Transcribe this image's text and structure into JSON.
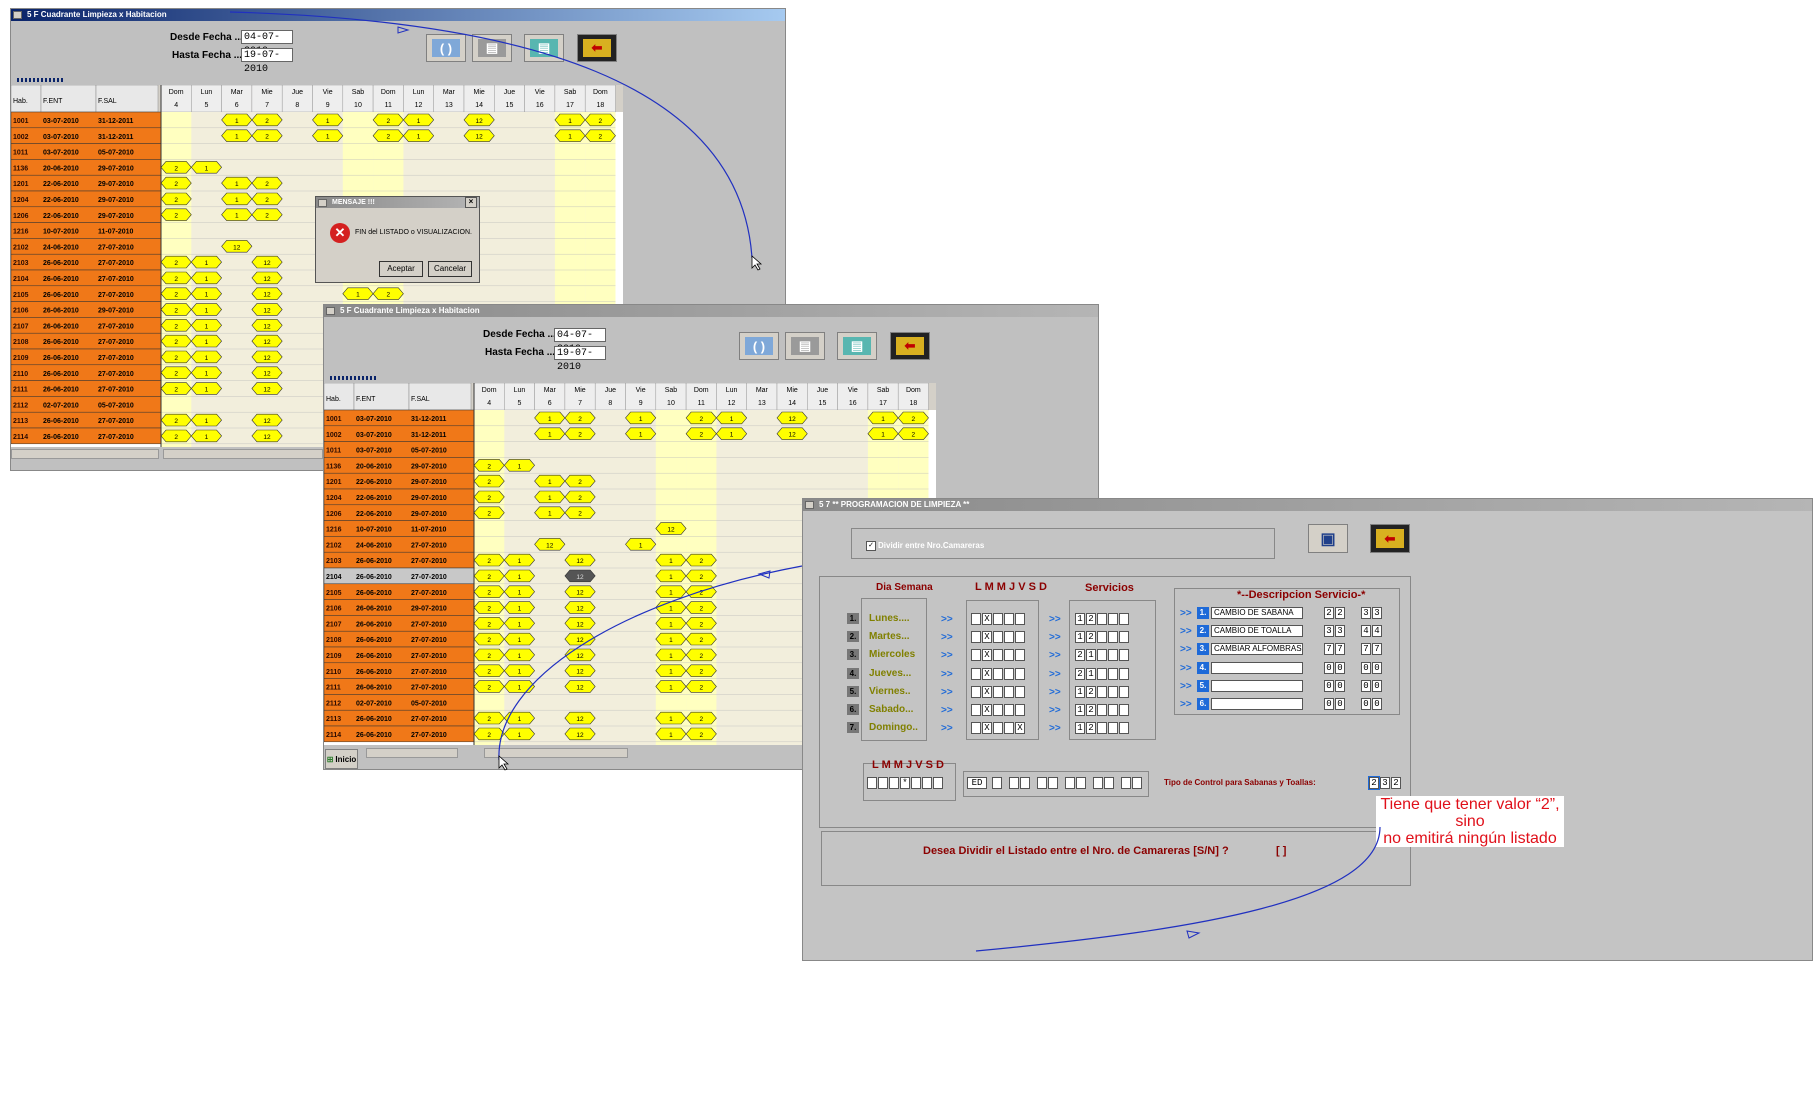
{
  "windows": {
    "w1_title": "5 F   Cuadrante Limpieza x Habitacion",
    "w2_title": "5 F   Cuadrante Limpieza x Habitacion",
    "w3_title": "5 7   ** PROGRAMACION DE LIMPIEZA **"
  },
  "filters": {
    "desde_label": "Desde  Fecha ...:",
    "hasta_label": "Hasta  Fecha ...:",
    "desde_value": "04-07-2010",
    "hasta_value": "19-07-2010"
  },
  "toolbar_icons": [
    "refresh-icon",
    "printer-icon",
    "printer-color-icon",
    "exit-icon"
  ],
  "grid": {
    "headers": [
      "Hab.",
      "F.ENT",
      "F.SAL"
    ],
    "days": [
      {
        "d": "Dom",
        "n": "4"
      },
      {
        "d": "Lun",
        "n": "5"
      },
      {
        "d": "Mar",
        "n": "6"
      },
      {
        "d": "Mie",
        "n": "7"
      },
      {
        "d": "Jue",
        "n": "8"
      },
      {
        "d": "Vie",
        "n": "9"
      },
      {
        "d": "Sab",
        "n": "10"
      },
      {
        "d": "Dom",
        "n": "11"
      },
      {
        "d": "Lun",
        "n": "12"
      },
      {
        "d": "Mar",
        "n": "13"
      },
      {
        "d": "Mie",
        "n": "14"
      },
      {
        "d": "Jue",
        "n": "15"
      },
      {
        "d": "Vie",
        "n": "16"
      },
      {
        "d": "Sab",
        "n": "17"
      },
      {
        "d": "Dom",
        "n": "18"
      }
    ],
    "rows1": [
      {
        "hab": "1001",
        "ent": "03-07-2010",
        "sal": "31-12-2011",
        "m": [
          [
            "2",
            "1"
          ],
          [
            "3",
            "2"
          ],
          [
            "5",
            "1"
          ],
          [
            "7",
            "2"
          ],
          [
            "8",
            "1"
          ],
          [
            "10",
            "12"
          ],
          [
            "13",
            "1"
          ],
          [
            "14",
            "2"
          ]
        ]
      },
      {
        "hab": "1002",
        "ent": "03-07-2010",
        "sal": "31-12-2011",
        "m": [
          [
            "2",
            "1"
          ],
          [
            "3",
            "2"
          ],
          [
            "5",
            "1"
          ],
          [
            "7",
            "2"
          ],
          [
            "8",
            "1"
          ],
          [
            "10",
            "12"
          ],
          [
            "13",
            "1"
          ],
          [
            "14",
            "2"
          ]
        ]
      },
      {
        "hab": "1011",
        "ent": "03-07-2010",
        "sal": "05-07-2010",
        "m": []
      },
      {
        "hab": "1136",
        "ent": "20-06-2010",
        "sal": "29-07-2010",
        "m": [
          [
            "0",
            "2"
          ],
          [
            "1",
            "1"
          ]
        ]
      },
      {
        "hab": "1201",
        "ent": "22-06-2010",
        "sal": "29-07-2010",
        "m": [
          [
            "0",
            "2"
          ],
          [
            "2",
            "1"
          ],
          [
            "3",
            "2"
          ]
        ]
      },
      {
        "hab": "1204",
        "ent": "22-06-2010",
        "sal": "29-07-2010",
        "m": [
          [
            "0",
            "2"
          ],
          [
            "2",
            "1"
          ],
          [
            "3",
            "2"
          ]
        ]
      },
      {
        "hab": "1206",
        "ent": "22-06-2010",
        "sal": "29-07-2010",
        "m": [
          [
            "0",
            "2"
          ],
          [
            "2",
            "1"
          ],
          [
            "3",
            "2"
          ]
        ]
      },
      {
        "hab": "1216",
        "ent": "10-07-2010",
        "sal": "11-07-2010",
        "m": []
      },
      {
        "hab": "2102",
        "ent": "24-06-2010",
        "sal": "27-07-2010",
        "m": [
          [
            "2",
            "12"
          ]
        ]
      },
      {
        "hab": "2103",
        "ent": "26-06-2010",
        "sal": "27-07-2010",
        "m": [
          [
            "0",
            "2"
          ],
          [
            "1",
            "1"
          ],
          [
            "3",
            "12"
          ]
        ]
      },
      {
        "hab": "2104",
        "ent": "26-06-2010",
        "sal": "27-07-2010",
        "m": [
          [
            "0",
            "2"
          ],
          [
            "1",
            "1"
          ],
          [
            "3",
            "12"
          ]
        ]
      },
      {
        "hab": "2105",
        "ent": "26-06-2010",
        "sal": "27-07-2010",
        "m": [
          [
            "0",
            "2"
          ],
          [
            "1",
            "1"
          ],
          [
            "3",
            "12"
          ],
          [
            "6",
            "1"
          ],
          [
            "7",
            "2"
          ]
        ]
      },
      {
        "hab": "2106",
        "ent": "26-06-2010",
        "sal": "29-07-2010",
        "m": [
          [
            "0",
            "2"
          ],
          [
            "1",
            "1"
          ],
          [
            "3",
            "12"
          ]
        ]
      },
      {
        "hab": "2107",
        "ent": "26-06-2010",
        "sal": "27-07-2010",
        "m": [
          [
            "0",
            "2"
          ],
          [
            "1",
            "1"
          ],
          [
            "3",
            "12"
          ]
        ]
      },
      {
        "hab": "2108",
        "ent": "26-06-2010",
        "sal": "27-07-2010",
        "m": [
          [
            "0",
            "2"
          ],
          [
            "1",
            "1"
          ],
          [
            "3",
            "12"
          ]
        ]
      },
      {
        "hab": "2109",
        "ent": "26-06-2010",
        "sal": "27-07-2010",
        "m": [
          [
            "0",
            "2"
          ],
          [
            "1",
            "1"
          ],
          [
            "3",
            "12"
          ]
        ]
      },
      {
        "hab": "2110",
        "ent": "26-06-2010",
        "sal": "27-07-2010",
        "m": [
          [
            "0",
            "2"
          ],
          [
            "1",
            "1"
          ],
          [
            "3",
            "12"
          ]
        ]
      },
      {
        "hab": "2111",
        "ent": "26-06-2010",
        "sal": "27-07-2010",
        "m": [
          [
            "0",
            "2"
          ],
          [
            "1",
            "1"
          ],
          [
            "3",
            "12"
          ]
        ]
      },
      {
        "hab": "2112",
        "ent": "02-07-2010",
        "sal": "05-07-2010",
        "m": []
      },
      {
        "hab": "2113",
        "ent": "26-06-2010",
        "sal": "27-07-2010",
        "m": [
          [
            "0",
            "2"
          ],
          [
            "1",
            "1"
          ],
          [
            "3",
            "12"
          ]
        ]
      },
      {
        "hab": "2114",
        "ent": "26-06-2010",
        "sal": "27-07-2010",
        "m": [
          [
            "0",
            "2"
          ],
          [
            "1",
            "1"
          ],
          [
            "3",
            "12"
          ]
        ]
      }
    ],
    "rows2": [
      {
        "hab": "1001",
        "ent": "03-07-2010",
        "sal": "31-12-2011",
        "m": [
          [
            "2",
            "1"
          ],
          [
            "3",
            "2"
          ],
          [
            "5",
            "1"
          ],
          [
            "7",
            "2"
          ],
          [
            "8",
            "1"
          ],
          [
            "10",
            "12"
          ],
          [
            "13",
            "1"
          ],
          [
            "14",
            "2"
          ]
        ]
      },
      {
        "hab": "1002",
        "ent": "03-07-2010",
        "sal": "31-12-2011",
        "m": [
          [
            "2",
            "1"
          ],
          [
            "3",
            "2"
          ],
          [
            "5",
            "1"
          ],
          [
            "7",
            "2"
          ],
          [
            "8",
            "1"
          ],
          [
            "10",
            "12"
          ],
          [
            "13",
            "1"
          ],
          [
            "14",
            "2"
          ]
        ]
      },
      {
        "hab": "1011",
        "ent": "03-07-2010",
        "sal": "05-07-2010",
        "m": []
      },
      {
        "hab": "1136",
        "ent": "20-06-2010",
        "sal": "29-07-2010",
        "m": [
          [
            "0",
            "2"
          ],
          [
            "1",
            "1"
          ]
        ]
      },
      {
        "hab": "1201",
        "ent": "22-06-2010",
        "sal": "29-07-2010",
        "m": [
          [
            "0",
            "2"
          ],
          [
            "2",
            "1"
          ],
          [
            "3",
            "2"
          ]
        ]
      },
      {
        "hab": "1204",
        "ent": "22-06-2010",
        "sal": "29-07-2010",
        "m": [
          [
            "0",
            "2"
          ],
          [
            "2",
            "1"
          ],
          [
            "3",
            "2"
          ]
        ]
      },
      {
        "hab": "1206",
        "ent": "22-06-2010",
        "sal": "29-07-2010",
        "m": [
          [
            "0",
            "2"
          ],
          [
            "2",
            "1"
          ],
          [
            "3",
            "2"
          ]
        ]
      },
      {
        "hab": "1216",
        "ent": "10-07-2010",
        "sal": "11-07-2010",
        "m": [
          [
            "6",
            "12"
          ]
        ]
      },
      {
        "hab": "2102",
        "ent": "24-06-2010",
        "sal": "27-07-2010",
        "m": [
          [
            "2",
            "12"
          ],
          [
            "5",
            "1"
          ]
        ]
      },
      {
        "hab": "2103",
        "ent": "26-06-2010",
        "sal": "27-07-2010",
        "m": [
          [
            "0",
            "2"
          ],
          [
            "1",
            "1"
          ],
          [
            "3",
            "12"
          ],
          [
            "6",
            "1"
          ],
          [
            "7",
            "2"
          ]
        ]
      },
      {
        "hab": "2104",
        "ent": "26-06-2010",
        "sal": "27-07-2010",
        "m": [
          [
            "0",
            "2"
          ],
          [
            "1",
            "1"
          ],
          [
            "3",
            "12"
          ],
          [
            "6",
            "1"
          ],
          [
            "7",
            "2"
          ]
        ],
        "sel": true
      },
      {
        "hab": "2105",
        "ent": "26-06-2010",
        "sal": "27-07-2010",
        "m": [
          [
            "0",
            "2"
          ],
          [
            "1",
            "1"
          ],
          [
            "3",
            "12"
          ],
          [
            "6",
            "1"
          ],
          [
            "7",
            "2"
          ]
        ]
      },
      {
        "hab": "2106",
        "ent": "26-06-2010",
        "sal": "29-07-2010",
        "m": [
          [
            "0",
            "2"
          ],
          [
            "1",
            "1"
          ],
          [
            "3",
            "12"
          ],
          [
            "6",
            "1"
          ],
          [
            "7",
            "2"
          ]
        ]
      },
      {
        "hab": "2107",
        "ent": "26-06-2010",
        "sal": "27-07-2010",
        "m": [
          [
            "0",
            "2"
          ],
          [
            "1",
            "1"
          ],
          [
            "3",
            "12"
          ],
          [
            "6",
            "1"
          ],
          [
            "7",
            "2"
          ]
        ]
      },
      {
        "hab": "2108",
        "ent": "26-06-2010",
        "sal": "27-07-2010",
        "m": [
          [
            "0",
            "2"
          ],
          [
            "1",
            "1"
          ],
          [
            "3",
            "12"
          ],
          [
            "6",
            "1"
          ],
          [
            "7",
            "2"
          ]
        ]
      },
      {
        "hab": "2109",
        "ent": "26-06-2010",
        "sal": "27-07-2010",
        "m": [
          [
            "0",
            "2"
          ],
          [
            "1",
            "1"
          ],
          [
            "3",
            "12"
          ],
          [
            "6",
            "1"
          ],
          [
            "7",
            "2"
          ]
        ]
      },
      {
        "hab": "2110",
        "ent": "26-06-2010",
        "sal": "27-07-2010",
        "m": [
          [
            "0",
            "2"
          ],
          [
            "1",
            "1"
          ],
          [
            "3",
            "12"
          ],
          [
            "6",
            "1"
          ],
          [
            "7",
            "2"
          ]
        ]
      },
      {
        "hab": "2111",
        "ent": "26-06-2010",
        "sal": "27-07-2010",
        "m": [
          [
            "0",
            "2"
          ],
          [
            "1",
            "1"
          ],
          [
            "3",
            "12"
          ],
          [
            "6",
            "1"
          ],
          [
            "7",
            "2"
          ]
        ]
      },
      {
        "hab": "2112",
        "ent": "02-07-2010",
        "sal": "05-07-2010",
        "m": []
      },
      {
        "hab": "2113",
        "ent": "26-06-2010",
        "sal": "27-07-2010",
        "m": [
          [
            "0",
            "2"
          ],
          [
            "1",
            "1"
          ],
          [
            "3",
            "12"
          ],
          [
            "6",
            "1"
          ],
          [
            "7",
            "2"
          ]
        ]
      },
      {
        "hab": "2114",
        "ent": "26-06-2010",
        "sal": "27-07-2010",
        "m": [
          [
            "0",
            "2"
          ],
          [
            "1",
            "1"
          ],
          [
            "3",
            "12"
          ],
          [
            "6",
            "1"
          ],
          [
            "7",
            "2"
          ]
        ]
      }
    ]
  },
  "dialog": {
    "title": "MENSAJE !!!",
    "message": "FIN del LISTADO o VISUALIZACION.",
    "ok": "Aceptar",
    "cancel": "Cancelar"
  },
  "taskbar": {
    "start": "Inicio"
  },
  "programacion": {
    "checkbox_label": "Dividir entre Nro.Camareras",
    "col_dia": "Dia Semana",
    "col_lmmjvsd": "L M M J V S D",
    "col_servicios": "Servicios",
    "col_descripcion": "*--Descripcion Servicio-*",
    "arrow": ">>",
    "days": [
      {
        "num": "1.",
        "name": "Lunes....",
        "marks": [
          "",
          "X",
          "",
          "",
          ""
        ],
        "serv": [
          "1",
          "2",
          "",
          "",
          ""
        ]
      },
      {
        "num": "2.",
        "name": "Martes...",
        "marks": [
          "",
          "X",
          "",
          "",
          ""
        ],
        "serv": [
          "1",
          "2",
          "",
          "",
          ""
        ]
      },
      {
        "num": "3.",
        "name": "Miercoles",
        "marks": [
          "",
          "X",
          "",
          "",
          ""
        ],
        "serv": [
          "2",
          "1",
          "",
          "",
          ""
        ]
      },
      {
        "num": "4.",
        "name": "Jueves...",
        "marks": [
          "",
          "X",
          "",
          "",
          ""
        ],
        "serv": [
          "2",
          "1",
          "",
          "",
          ""
        ]
      },
      {
        "num": "5.",
        "name": "Viernes..",
        "marks": [
          "",
          "X",
          "",
          "",
          ""
        ],
        "serv": [
          "1",
          "2",
          "",
          "",
          ""
        ]
      },
      {
        "num": "6.",
        "name": "Sabado...",
        "marks": [
          "",
          "X",
          "",
          "",
          ""
        ],
        "serv": [
          "1",
          "2",
          "",
          "",
          ""
        ]
      },
      {
        "num": "7.",
        "name": "Domingo..",
        "marks": [
          "",
          "X",
          "",
          "",
          "X"
        ],
        "serv": [
          "1",
          "2",
          "",
          "",
          ""
        ]
      }
    ],
    "services": [
      {
        "num": "1.",
        "desc": "CAMBIO DE SABANA",
        "a": "2",
        "b": "2",
        "c": "3",
        "d": "3"
      },
      {
        "num": "2.",
        "desc": "CAMBIO DE TOALLA",
        "a": "3",
        "b": "3",
        "c": "4",
        "d": "4"
      },
      {
        "num": "3.",
        "desc": "CAMBIAR ALFOMBRAS",
        "a": "7",
        "b": "7",
        "c": "7",
        "d": "7"
      },
      {
        "num": "4.",
        "desc": "",
        "a": "0",
        "b": "0",
        "c": "0",
        "d": "0"
      },
      {
        "num": "5.",
        "desc": "",
        "a": "0",
        "b": "0",
        "c": "0",
        "d": "0"
      },
      {
        "num": "6.",
        "desc": "",
        "a": "0",
        "b": "0",
        "c": "0",
        "d": "0"
      }
    ],
    "bottom_lmmjvsd": "L M M J V S D",
    "bottom_marks": [
      "",
      "",
      "",
      "*",
      "",
      "",
      ""
    ],
    "ed_value": "ED",
    "tipo_label": "Tipo de Control para Sabanas y Toallas:",
    "tipo_values": [
      "2",
      "3",
      "2"
    ],
    "question": "Desea Dividir el Listado entre el Nro. de Camareras [S/N] ?",
    "answer": "[ ]"
  },
  "annotation": {
    "line1": "Tiene que tener valor “2”, sino",
    "line2": "no emitirá ningún listado"
  }
}
